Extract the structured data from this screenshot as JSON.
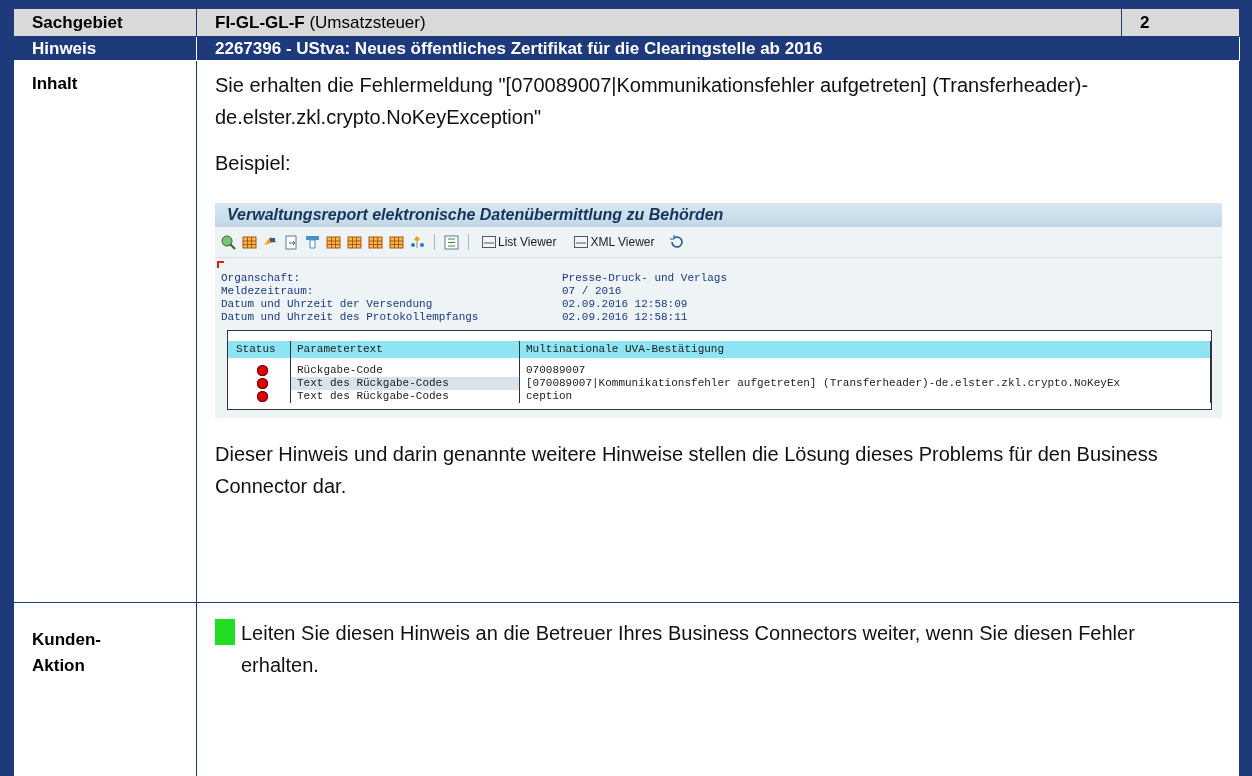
{
  "header": {
    "label": "Sachgebiet",
    "value": "**FI-GL-GL-F** (Umsatzsteuer)",
    "number": "2"
  },
  "note": {
    "label": "Hinweis",
    "title": "2267396 - UStva: Neues öffentliches Zertifikat für die Clearingstelle ab 2016"
  },
  "content": {
    "label": "Inhalt",
    "intro": "Sie erhalten die Fehlermeldung \"[070089007|Kommunikationsfehler aufgetreten] (Transferheader)-de.elster.zkl.crypto.NoKeyException\"",
    "example_label": "Beispiel:",
    "screenshot": {
      "title": "Verwaltungsreport elektronische Datenübermittlung zu Behörden",
      "toolbar_buttons": [
        "List Viewer",
        "XML Viewer"
      ],
      "info": [
        {
          "label": "Organschaft:",
          "value": "Presse-Druck- und Verlags"
        },
        {
          "label": "Meldezeitraum:",
          "value": "07 / 2016"
        },
        {
          "label": "Datum und Uhrzeit der Versendung",
          "value": "02.09.2016 12:58:09"
        },
        {
          "label": "Datum und Uhrzeit des Protokollempfangs",
          "value": "02.09.2016 12:58:11"
        }
      ],
      "columns": [
        "Status",
        "Parametertext",
        "Multinationale UVA-Bestätigung"
      ],
      "rows": [
        {
          "color": "#e00000",
          "selected": false,
          "parameter": "Rückgabe-Code",
          "value": "070089007"
        },
        {
          "color": "#e00000",
          "selected": true,
          "parameter": "Text des Rückgabe-Codes",
          "value": "[070089007|Kommunikationsfehler aufgetreten] (Transferheader)-de.elster.zkl.crypto.NoKeyEx"
        },
        {
          "color": "#e00000",
          "selected": false,
          "parameter": "Text des Rückgabe-Codes",
          "value": "ception"
        }
      ]
    },
    "conclusion": "Dieser Hinweis und darin genannte weitere Hinweise stellen die Lösung dieses Problems für den Business Connector dar."
  },
  "action": {
    "label": "Kunden-\nAktion",
    "text": "Leiten Sie diesen Hinweis an die Betreuer Ihres Business Connectors weiter, wenn Sie diesen Fehler erhalten."
  }
}
